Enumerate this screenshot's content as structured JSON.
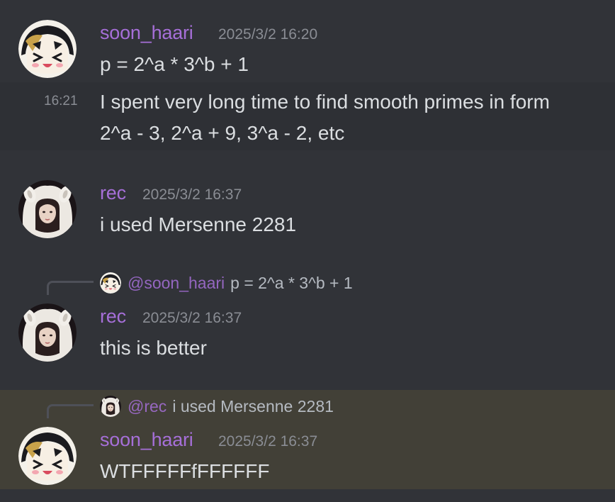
{
  "messages": [
    {
      "author": "soon_haari",
      "timestamp": "2025/3/2 16:20",
      "lines": [
        "p = 2^a * 3^b + 1"
      ]
    },
    {
      "side_timestamp": "16:21",
      "lines": [
        "I spent very long time to find smooth primes in form",
        "2^a - 3, 2^a + 9, 3^a - 2, etc"
      ]
    },
    {
      "author": "rec",
      "timestamp": "2025/3/2 16:37",
      "lines": [
        "i used Mersenne 2281"
      ]
    },
    {
      "reply": {
        "name": "@soon_haari",
        "text": "p = 2^a * 3^b + 1"
      },
      "author": "rec",
      "timestamp": "2025/3/2 16:37",
      "lines": [
        "this is better"
      ]
    },
    {
      "reply": {
        "name": "@rec",
        "text": "i used Mersenne 2281"
      },
      "author": "soon_haari",
      "timestamp": "2025/3/2 16:37",
      "lines": [
        "WTFFFFFfFFFFFF"
      ]
    }
  ],
  "colors": {
    "background": "#313338",
    "username": "#a66fd8",
    "mention_highlight": "#424037",
    "text": "#dbdee1",
    "timestamp": "#8a8d94"
  },
  "icons": {
    "soon_haari_avatar": "anime-character-avatar",
    "rec_avatar": "person-in-white-hood-avatar"
  }
}
